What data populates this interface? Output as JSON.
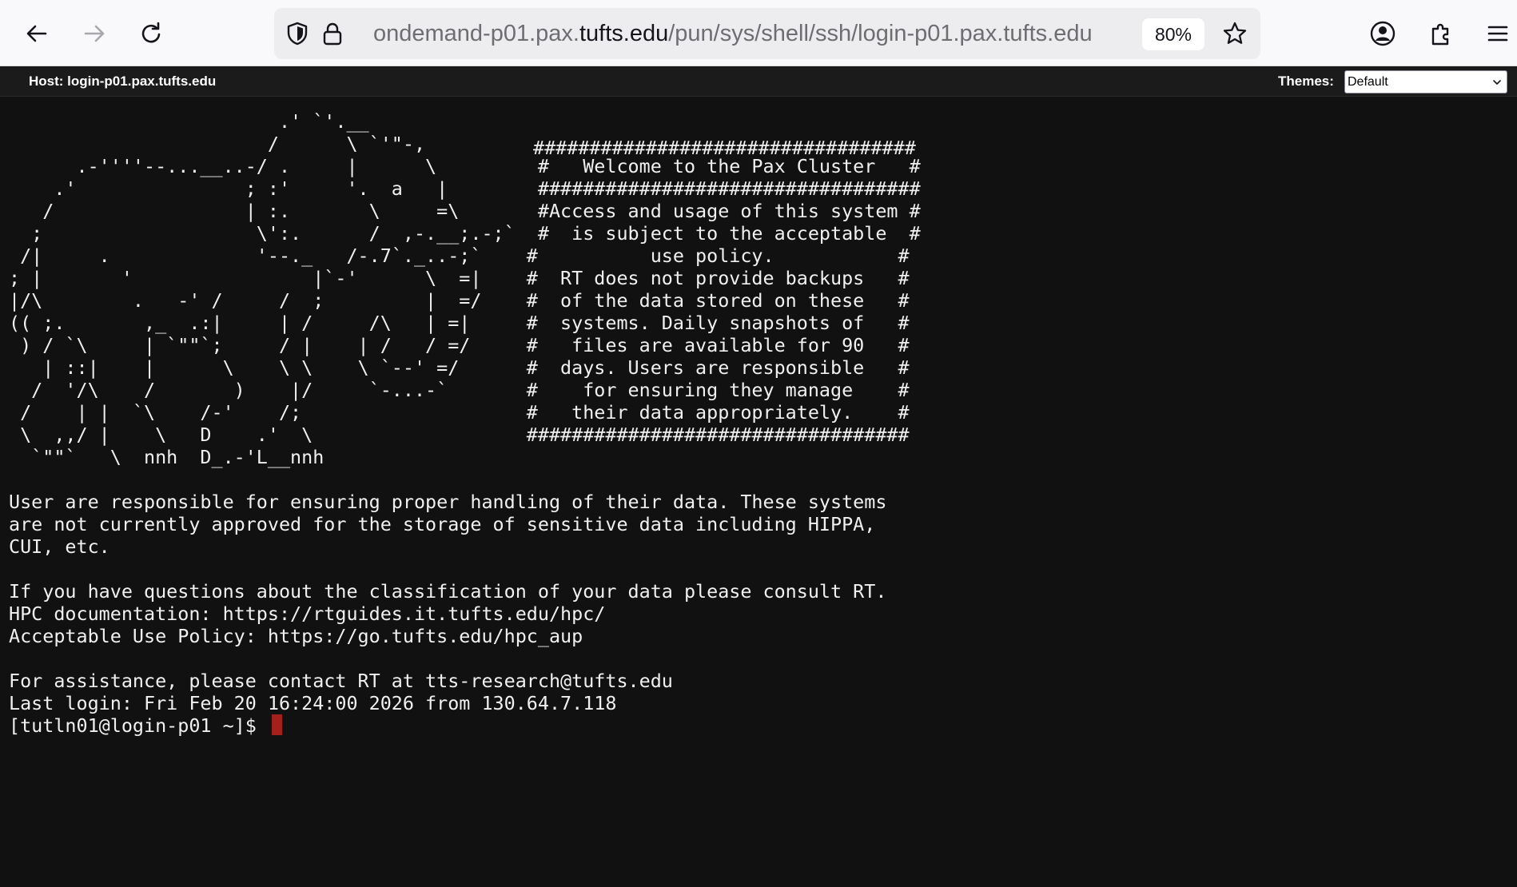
{
  "browser": {
    "url_prefix": "ondemand-p01.pax.",
    "url_domain": "tufts.edu",
    "url_suffix": "/pun/sys/shell/ssh/login-p01.pax.tufts.edu",
    "zoom": "80%",
    "icons": {
      "back": "back-arrow-icon",
      "forward": "forward-arrow-icon",
      "reload": "reload-icon",
      "shield": "shield-icon",
      "lock": "lock-icon",
      "bookmark": "star-icon",
      "account": "account-icon",
      "extensions": "puzzle-icon",
      "menu": "hamburger-menu-icon"
    }
  },
  "shell_header": {
    "host": "Host: login-p01.pax.tufts.edu",
    "themes_label": "Themes:",
    "theme_selected": "Default"
  },
  "terminal": {
    "lines": [
      "                        .' `'.__",
      "                       /      \\ `'\"-,",
      "      .-''''--...__..-/ .     |      \\         #   Welcome to the Pax Cluster   #",
      "    .'               ; :'     '.  a   |        ##################################",
      "   /                 | :.       \\     =\\       #Access and usage of this system #",
      "  ;                   \\':.      /  ,-.__;.-;`  #  is subject to the acceptable  #",
      " /|     .             '--._   /-.7`._..-;`    #          use policy.           #",
      "; |       '                |`-'      \\  =|    #  RT does not provide backups   #",
      "|/\\        .   -' /     /  ;         |  =/    #  of the data stored on these   #",
      "(( ;.       ,_  .:|     | /     /\\   | =|     #  systems. Daily snapshots of   #",
      " ) / `\\     | `\"\"`;     / |    | /   / =/     #   files are available for 90   #",
      "   | ::|    |      \\    \\ \\    \\ `--' =/      #  days. Users are responsible   #",
      "  /  '/\\    /       )    |/     `-...-`       #    for ensuring they manage    #",
      " /    | |  `\\    /-'    /;                    #   their data appropriately.    #",
      " \\  ,,/ |    \\   D    .'  \\                   ##################################",
      "  `\"\"`   \\  nnh  D_.-'L__nnh",
      "",
      "User are responsible for ensuring proper handling of their data. These systems",
      "are not currently approved for the storage of sensitive data including HIPPA,",
      "CUI, etc.",
      "",
      "If you have questions about the classification of your data please consult RT.",
      "HPC documentation: https://rtguides.it.tufts.edu/hpc/",
      "Acceptable Use Policy: https://go.tufts.edu/hpc_aup",
      "",
      "For assistance, please contact RT at tts-research@tufts.edu",
      "Last login: Fri Feb 20 16:24:00 2026 from 130.64.7.118",
      "[tutln01@login-p01 ~]$ "
    ],
    "banner_top_border": "##################################",
    "cursor_color": "#a3201d"
  },
  "colors": {
    "terminal_bg": "#111111",
    "terminal_fg": "#f0f0f0",
    "header_bg": "#1b1b1b",
    "toolbar_bg": "#f9f9fb"
  }
}
